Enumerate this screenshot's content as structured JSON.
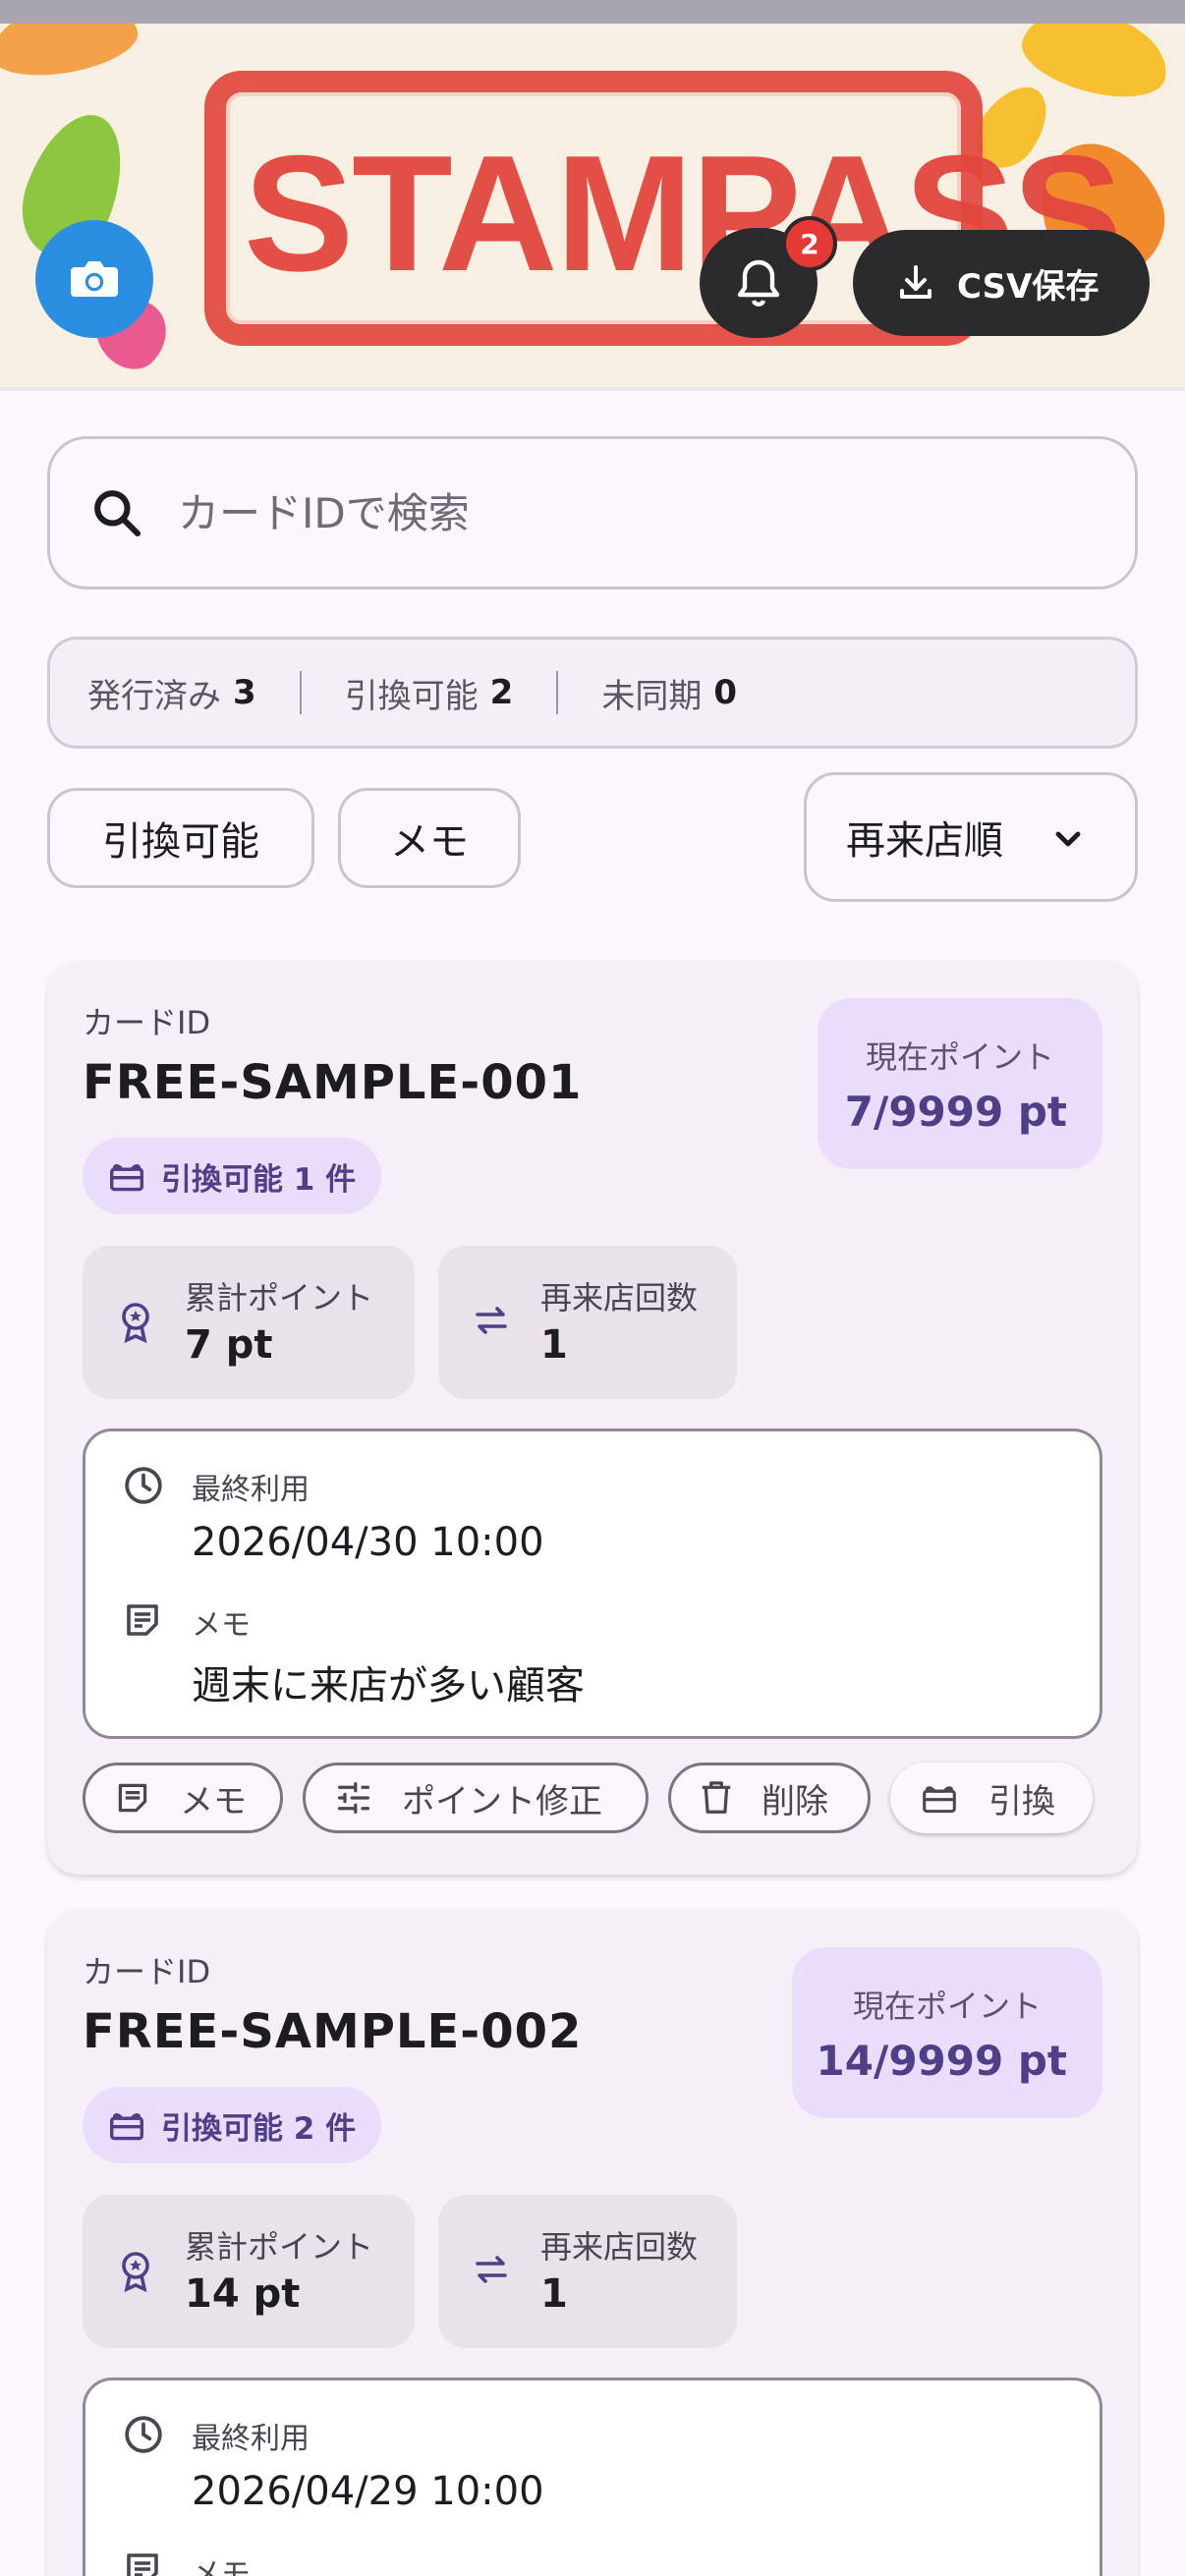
{
  "header": {
    "logo_text": "STAMPASS",
    "notification_count": "2",
    "csv_label": "CSV保存"
  },
  "search": {
    "placeholder": "カードIDで検索",
    "value": ""
  },
  "stats": {
    "issued_label": "発行済み",
    "issued_value": "3",
    "redeemable_label": "引換可能",
    "redeemable_value": "2",
    "unsynced_label": "未同期",
    "unsynced_value": "0"
  },
  "filters": {
    "redeemable": "引換可能",
    "memo": "メモ"
  },
  "sort": {
    "selected": "再来店順"
  },
  "cards": [
    {
      "id_label": "カードID",
      "id": "FREE-SAMPLE-001",
      "points_label": "現在ポイント",
      "points": "7/9999 pt",
      "redeem_badge": "引換可能 1 件",
      "total_label": "累計ポイント",
      "total_value": "7 pt",
      "visits_label": "再来店回数",
      "visits_value": "1",
      "last_used_label": "最終利用",
      "last_used_value": "2026/04/30 10:00",
      "memo_label": "メモ",
      "memo_value": "週末に来店が多い顧客",
      "actions": {
        "memo": "メモ",
        "adjust": "ポイント修正",
        "delete": "削除",
        "redeem": "引換"
      }
    },
    {
      "id_label": "カードID",
      "id": "FREE-SAMPLE-002",
      "points_label": "現在ポイント",
      "points": "14/9999 pt",
      "redeem_badge": "引換可能 2 件",
      "total_label": "累計ポイント",
      "total_value": "14 pt",
      "visits_label": "再来店回数",
      "visits_value": "1",
      "last_used_label": "最終利用",
      "last_used_value": "2026/04/29 10:00",
      "memo_label": "メモ"
    }
  ],
  "colors": {
    "accent": "#4f3f86",
    "accent_container": "#e9ddfb",
    "stamp_red": "#e2473f",
    "camera_blue": "#2a8fe0",
    "badge_red": "#e53935"
  }
}
